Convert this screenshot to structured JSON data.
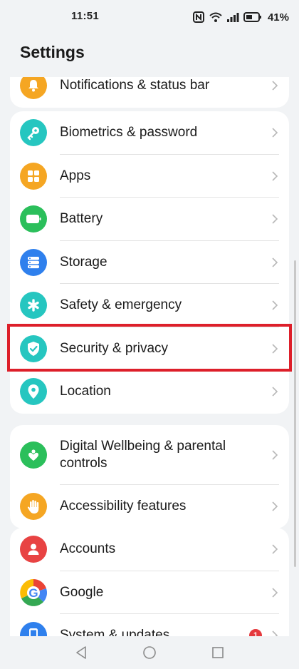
{
  "status_bar": {
    "time": "11:51",
    "battery_percent": "41%"
  },
  "header": {
    "title": "Settings"
  },
  "groups": [
    {
      "items": [
        {
          "label": "Notifications & status bar",
          "icon": "bell-icon",
          "color": "#f5a623"
        }
      ]
    },
    {
      "items": [
        {
          "label": "Biometrics & password",
          "icon": "key-icon",
          "color": "#26c6c0"
        },
        {
          "label": "Apps",
          "icon": "apps-grid-icon",
          "color": "#f5a623"
        },
        {
          "label": "Battery",
          "icon": "battery-icon",
          "color": "#2bbf5b"
        },
        {
          "label": "Storage",
          "icon": "storage-icon",
          "color": "#2f80ed"
        },
        {
          "label": "Safety & emergency",
          "icon": "asterisk-icon",
          "color": "#26c6c0"
        },
        {
          "label": "Security & privacy",
          "icon": "shield-check-icon",
          "color": "#26c6c0"
        },
        {
          "label": "Location",
          "icon": "location-pin-icon",
          "color": "#26c6c0"
        }
      ]
    },
    {
      "items": [
        {
          "label": "Digital Wellbeing & parental controls",
          "icon": "wellbeing-heart-icon",
          "color": "#2bbf5b"
        },
        {
          "label": "Accessibility features",
          "icon": "hand-icon",
          "color": "#f5a623"
        }
      ]
    },
    {
      "items": [
        {
          "label": "Accounts",
          "icon": "person-icon",
          "color": "#e84343"
        },
        {
          "label": "Google",
          "icon": "google-icon",
          "color": "#4285f4"
        },
        {
          "label": "System & updates",
          "icon": "phone-icon",
          "color": "#2f80ed",
          "badge": "1"
        }
      ]
    }
  ],
  "highlight": {
    "color": "#dd1f2a"
  }
}
